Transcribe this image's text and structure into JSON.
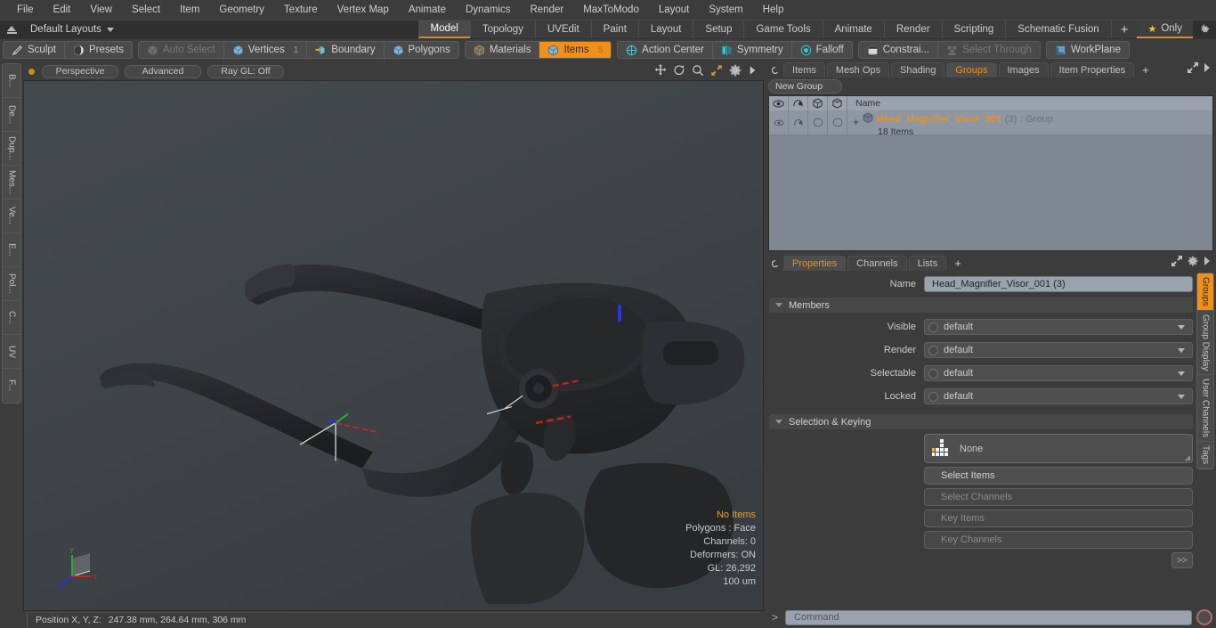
{
  "menu": {
    "items": [
      "File",
      "Edit",
      "View",
      "Select",
      "Item",
      "Geometry",
      "Texture",
      "Vertex Map",
      "Animate",
      "Dynamics",
      "Render",
      "MaxToModo",
      "Layout",
      "System",
      "Help"
    ]
  },
  "layoutbar": {
    "home_icon": "home-up-icon",
    "layout_label": "Default Layouts",
    "tabs": [
      {
        "label": "Model",
        "active": true
      },
      {
        "label": "Topology",
        "active": false
      },
      {
        "label": "UVEdit",
        "active": false
      },
      {
        "label": "Paint",
        "active": false
      },
      {
        "label": "Layout",
        "active": false
      },
      {
        "label": "Setup",
        "active": false
      },
      {
        "label": "Game Tools",
        "active": false
      },
      {
        "label": "Animate",
        "active": false
      },
      {
        "label": "Render",
        "active": false
      },
      {
        "label": "Scripting",
        "active": false
      },
      {
        "label": "Schematic Fusion",
        "active": false
      }
    ],
    "add_tab_label": "+",
    "only_label": "Only",
    "star_icon": "star-icon",
    "gear_icon": "gear-icon"
  },
  "toolbar": {
    "group1": [
      {
        "label": "Sculpt",
        "icon": "sculpt-brush-icon",
        "state": "normal",
        "badge": ""
      },
      {
        "label": "Presets",
        "icon": "presets-sphere-icon",
        "state": "normal",
        "badge": ""
      }
    ],
    "group2": [
      {
        "label": "Auto Select",
        "icon": "cube-grey-icon",
        "state": "dim",
        "badge": ""
      },
      {
        "label": "Vertices",
        "icon": "cube-blue-icon",
        "state": "normal",
        "badge": "1"
      },
      {
        "label": "Boundary",
        "icon": "boundary-icon",
        "state": "normal",
        "badge": ""
      },
      {
        "label": "Polygons",
        "icon": "cube-blue-icon",
        "state": "normal",
        "badge": ""
      }
    ],
    "group3": [
      {
        "label": "Materials",
        "icon": "cube-orange-icon",
        "state": "normal",
        "badge": ""
      },
      {
        "label": "Items",
        "icon": "cube-blue-icon",
        "state": "active",
        "badge": "5"
      }
    ],
    "group4": [
      {
        "label": "Action Center",
        "icon": "action-center-icon",
        "state": "normal",
        "badge": ""
      },
      {
        "label": "Symmetry",
        "icon": "symmetry-icon",
        "state": "normal",
        "badge": ""
      },
      {
        "label": "Falloff",
        "icon": "falloff-icon",
        "state": "normal",
        "badge": ""
      }
    ],
    "group5": [
      {
        "label": "Constrai...",
        "icon": "constraint-icon",
        "state": "normal",
        "badge": ""
      },
      {
        "label": "Select Through",
        "icon": "select-through-icon",
        "state": "dim",
        "badge": ""
      }
    ],
    "group6": [
      {
        "label": "WorkPlane",
        "icon": "workplane-icon",
        "state": "normal",
        "badge": ""
      }
    ]
  },
  "left_strip": {
    "tabs": [
      "B...",
      "De...",
      "Dup...",
      "Mes...",
      "Ve...",
      "E...",
      "Pol...",
      "C...",
      "UV",
      "F..."
    ]
  },
  "viewport": {
    "status_dot": "record-dot-icon",
    "buttons": [
      {
        "label": "Perspective",
        "name": "viewport-projection-button"
      },
      {
        "label": "Advanced",
        "name": "viewport-shading-button"
      },
      {
        "label": "Ray GL: Off",
        "name": "viewport-raygl-button"
      }
    ],
    "tools": [
      "move-icon",
      "rotate-icon",
      "zoom-icon",
      "fit-icon",
      "gear-icon",
      "play-icon"
    ],
    "stats": [
      {
        "text": "No Items",
        "highlight": true
      },
      {
        "text": "Polygons : Face",
        "highlight": false
      },
      {
        "text": "Channels: 0",
        "highlight": false
      },
      {
        "text": "Deformers: ON",
        "highlight": false
      },
      {
        "text": "GL: 26,292",
        "highlight": false
      },
      {
        "text": "100 um",
        "highlight": false
      }
    ],
    "gizmo": {
      "x": "X",
      "y": "Y",
      "z": "Z"
    }
  },
  "statusbar": {
    "position_label": "Position X, Y, Z:",
    "position_value": "247.38 mm, 264.64 mm, 306 mm"
  },
  "right_panel": {
    "tabs": [
      {
        "label": "Items",
        "active": false
      },
      {
        "label": "Mesh Ops",
        "active": false
      },
      {
        "label": "Shading",
        "active": false
      },
      {
        "label": "Groups",
        "active": true
      },
      {
        "label": "Images",
        "active": false
      },
      {
        "label": "Item Properties",
        "active": false
      }
    ],
    "add_tab_label": "+",
    "expand_icon": "expand-icon",
    "more_icon": "chevron-right-icon",
    "new_group_label": "New Group",
    "list": {
      "columns": [
        "eye-icon",
        "render-icon",
        "wireframe-icon",
        "shaded-icon",
        "Name"
      ],
      "rows": [
        {
          "name": "Head_Magnifier_Visor_001",
          "count": "(3)",
          "type": ": Group",
          "sub": "18 Items",
          "icon": "group-cube-icon",
          "expander": "+"
        }
      ]
    }
  },
  "properties": {
    "tabs": [
      {
        "label": "Properties",
        "active": true
      },
      {
        "label": "Channels",
        "active": false
      },
      {
        "label": "Lists",
        "active": false
      }
    ],
    "add_tab_label": "+",
    "expand_icon": "expand-icon",
    "gear_icon": "gear-icon",
    "more_icon": "chevron-right-icon",
    "name_label": "Name",
    "name_value": "Head_Magnifier_Visor_001 (3)",
    "members_section": "Members",
    "members_rows": [
      {
        "label": "Visible",
        "value": "default"
      },
      {
        "label": "Render",
        "value": "default"
      },
      {
        "label": "Selectable",
        "value": "default"
      },
      {
        "label": "Locked",
        "value": "default"
      }
    ],
    "selection_section": "Selection & Keying",
    "selection_target": "None",
    "selection_target_icon": "grid-dots-icon",
    "buttons": [
      {
        "label": "Select Items",
        "disabled": false
      },
      {
        "label": "Select Channels",
        "disabled": true
      },
      {
        "label": "Key Items",
        "disabled": true
      },
      {
        "label": "Key Channels",
        "disabled": true
      }
    ],
    "forward_label": ">>"
  },
  "right_strip": {
    "tabs": [
      {
        "label": "Groups",
        "active": true
      },
      {
        "label": "Group Display",
        "active": false
      },
      {
        "label": "User Channels",
        "active": false
      },
      {
        "label": "Tags",
        "active": false
      }
    ]
  },
  "command": {
    "prompt": ">",
    "placeholder": "Command",
    "record_icon": "record-circle-icon"
  },
  "colors": {
    "accent_orange": "#f0901a",
    "panel_bg": "#3c3c3c",
    "viewport_bg": "#3f4548",
    "list_bg": "#8d96a1",
    "field_bg": "#9aa3ad"
  }
}
